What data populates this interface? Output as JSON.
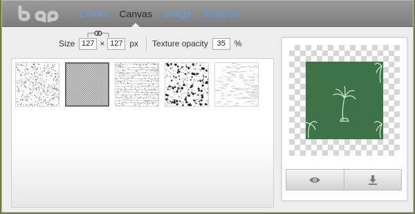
{
  "app": {
    "logo_text": "bgp"
  },
  "nav": {
    "items": [
      {
        "label": "Colors",
        "active": false
      },
      {
        "label": "Canvas",
        "active": true
      },
      {
        "label": "Image",
        "active": false
      },
      {
        "label": "Rotation",
        "active": false
      }
    ]
  },
  "controls": {
    "size_label": "Size",
    "width_value": "127",
    "times_symbol": "×",
    "height_value": "127",
    "px_label": "px",
    "opacity_label": "Texture opacity",
    "opacity_value": "35",
    "percent_label": "%"
  },
  "textures": {
    "selected_index": 1,
    "count": 5
  },
  "preview": {
    "swatch_color": "#3c7447",
    "view_icon": "eye-icon",
    "download_icon": "download-icon"
  },
  "colors": {
    "link": "#5ea0e6",
    "active_nav": "#2a2a2a",
    "background": "#6f7a3c"
  }
}
